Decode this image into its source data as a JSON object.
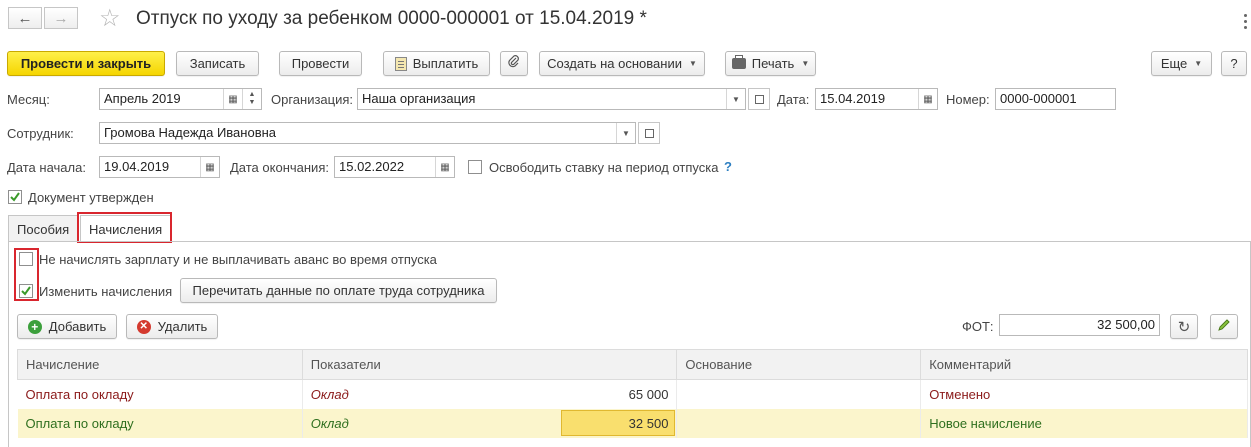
{
  "window": {
    "title": "Отпуск по уходу за ребенком 0000-000001 от 15.04.2019 *"
  },
  "toolbar": {
    "post_close": "Провести и закрыть",
    "write": "Записать",
    "post": "Провести",
    "pay": "Выплатить",
    "create_based": "Создать на основании",
    "print": "Печать",
    "more": "Еще",
    "help": "?"
  },
  "header": {
    "month_label": "Месяц:",
    "month_value": "Апрель 2019",
    "org_label": "Организация:",
    "org_value": "Наша организация",
    "date_label": "Дата:",
    "date_value": "15.04.2019",
    "number_label": "Номер:",
    "number_value": "0000-000001",
    "employee_label": "Сотрудник:",
    "employee_value": "Громова Надежда Ивановна",
    "start_label": "Дата начала:",
    "start_value": "19.04.2019",
    "end_label": "Дата окончания:",
    "end_value": "15.02.2022",
    "free_rate_label": "Освободить ставку на период отпуска",
    "free_rate_checked": false,
    "help_mark": "?",
    "approved_label": "Документ утвержден",
    "approved_checked": true
  },
  "tabs": [
    {
      "label": "Пособия",
      "active": false
    },
    {
      "label": "Начисления",
      "active": true
    }
  ],
  "accruals": {
    "no_salary_label": "Не начислять зарплату и не выплачивать аванс во время отпуска",
    "no_salary_checked": false,
    "change_label": "Изменить начисления",
    "change_checked": true,
    "reread_button": "Перечитать данные по оплате труда сотрудника",
    "add_button": "Добавить",
    "delete_button": "Удалить",
    "fot_label": "ФОТ:",
    "fot_value": "32 500,00",
    "columns": [
      "Начисление",
      "Показатели",
      "Основание",
      "Комментарий"
    ],
    "rows": [
      {
        "name": "Оплата по окладу",
        "indicator": "Оклад",
        "value": "65 000",
        "basis": "",
        "comment": "Отменено"
      },
      {
        "name": "Оплата по окладу",
        "indicator": "Оклад",
        "value": "32 500",
        "basis": "",
        "comment": "Новое начисление"
      }
    ]
  },
  "colors": {
    "primary_button": "#f5d500",
    "highlight_red": "#d9262e",
    "cancelled_text": "#8b1a1a",
    "new_text": "#2f6f1f",
    "selected_row": "#fbf5cc"
  }
}
